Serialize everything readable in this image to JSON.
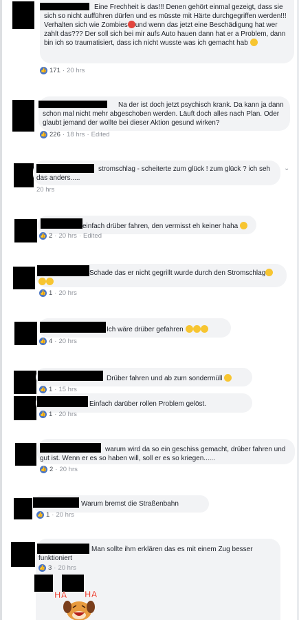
{
  "comments": [
    {
      "text": "Eine Frechheit is das!!! Denen gehört einmal gezeigt, dass sie sich so nicht aufführen dürfen und es müsste mit Härte durchgegriffen werden!!! Verhalten sich wie Zombies",
      "text2": "und wenn das jetzt eine Beschädigung hat wer zahlt das??? Der soll sich bei mir aufs Auto hauen dann hat er a Problem, dann bin ich so traumatisiert, dass ich nicht wusste was ich gemacht hab",
      "likes": "171",
      "time": "20 hrs",
      "edited": ""
    },
    {
      "text": "Na der ist doch jetzt psychisch krank. Da kann ja dann schon mal nicht mehr abgeschoben werden. Läuft doch alles nach Plan. Oder glaubt jemand der wollte bei dieser Aktion gesund wirken?",
      "likes": "226",
      "time": "18 hrs",
      "edited": "Edited"
    },
    {
      "text": "stromschlag - scheiterte zum glück ! zum glück ? ich seh das anders.....",
      "likes": "",
      "time": "20 hrs",
      "edited": ""
    },
    {
      "text": "einfach drüber fahren, den vermisst eh keiner haha",
      "likes": "2",
      "time": "20 hrs",
      "edited": "Edited"
    },
    {
      "text": "Schade das er nicht gegrillt wurde durch den Stromschlag",
      "likes": "1",
      "time": "20 hrs",
      "edited": ""
    },
    {
      "text": "Ich wäre drüber gefahren",
      "likes": "4",
      "time": "20 hrs",
      "edited": ""
    },
    {
      "text": "Drüber fahren und ab zum sondermüll",
      "likes": "1",
      "time": "15 hrs",
      "edited": ""
    },
    {
      "text": "Einfach darüber rollen Problem gelöst.",
      "likes": "1",
      "time": "20 hrs",
      "edited": ""
    },
    {
      "text": "warum wird da so ein geschiss gemacht, drüber fahren und gut ist. Wenn er es so haben will, soll er es so kriegen......",
      "likes": "2",
      "time": "20 hrs",
      "edited": ""
    },
    {
      "text": "Warum bremst die Straßenbahn",
      "likes": "1",
      "time": "20 hrs",
      "edited": ""
    },
    {
      "text": "Man sollte ihm erklären das es mit einem Zug besser funktioniert",
      "likes": "3",
      "time": "20 hrs",
      "edited": ""
    }
  ],
  "gif": {
    "label_left": "HA",
    "label_right": "HA"
  },
  "icons": {
    "like": "like-icon",
    "menu": "chevron-down-icon"
  },
  "colors": {
    "bubble": "#f2f3f5",
    "like": "#4a76c5",
    "meta": "#90949c"
  }
}
